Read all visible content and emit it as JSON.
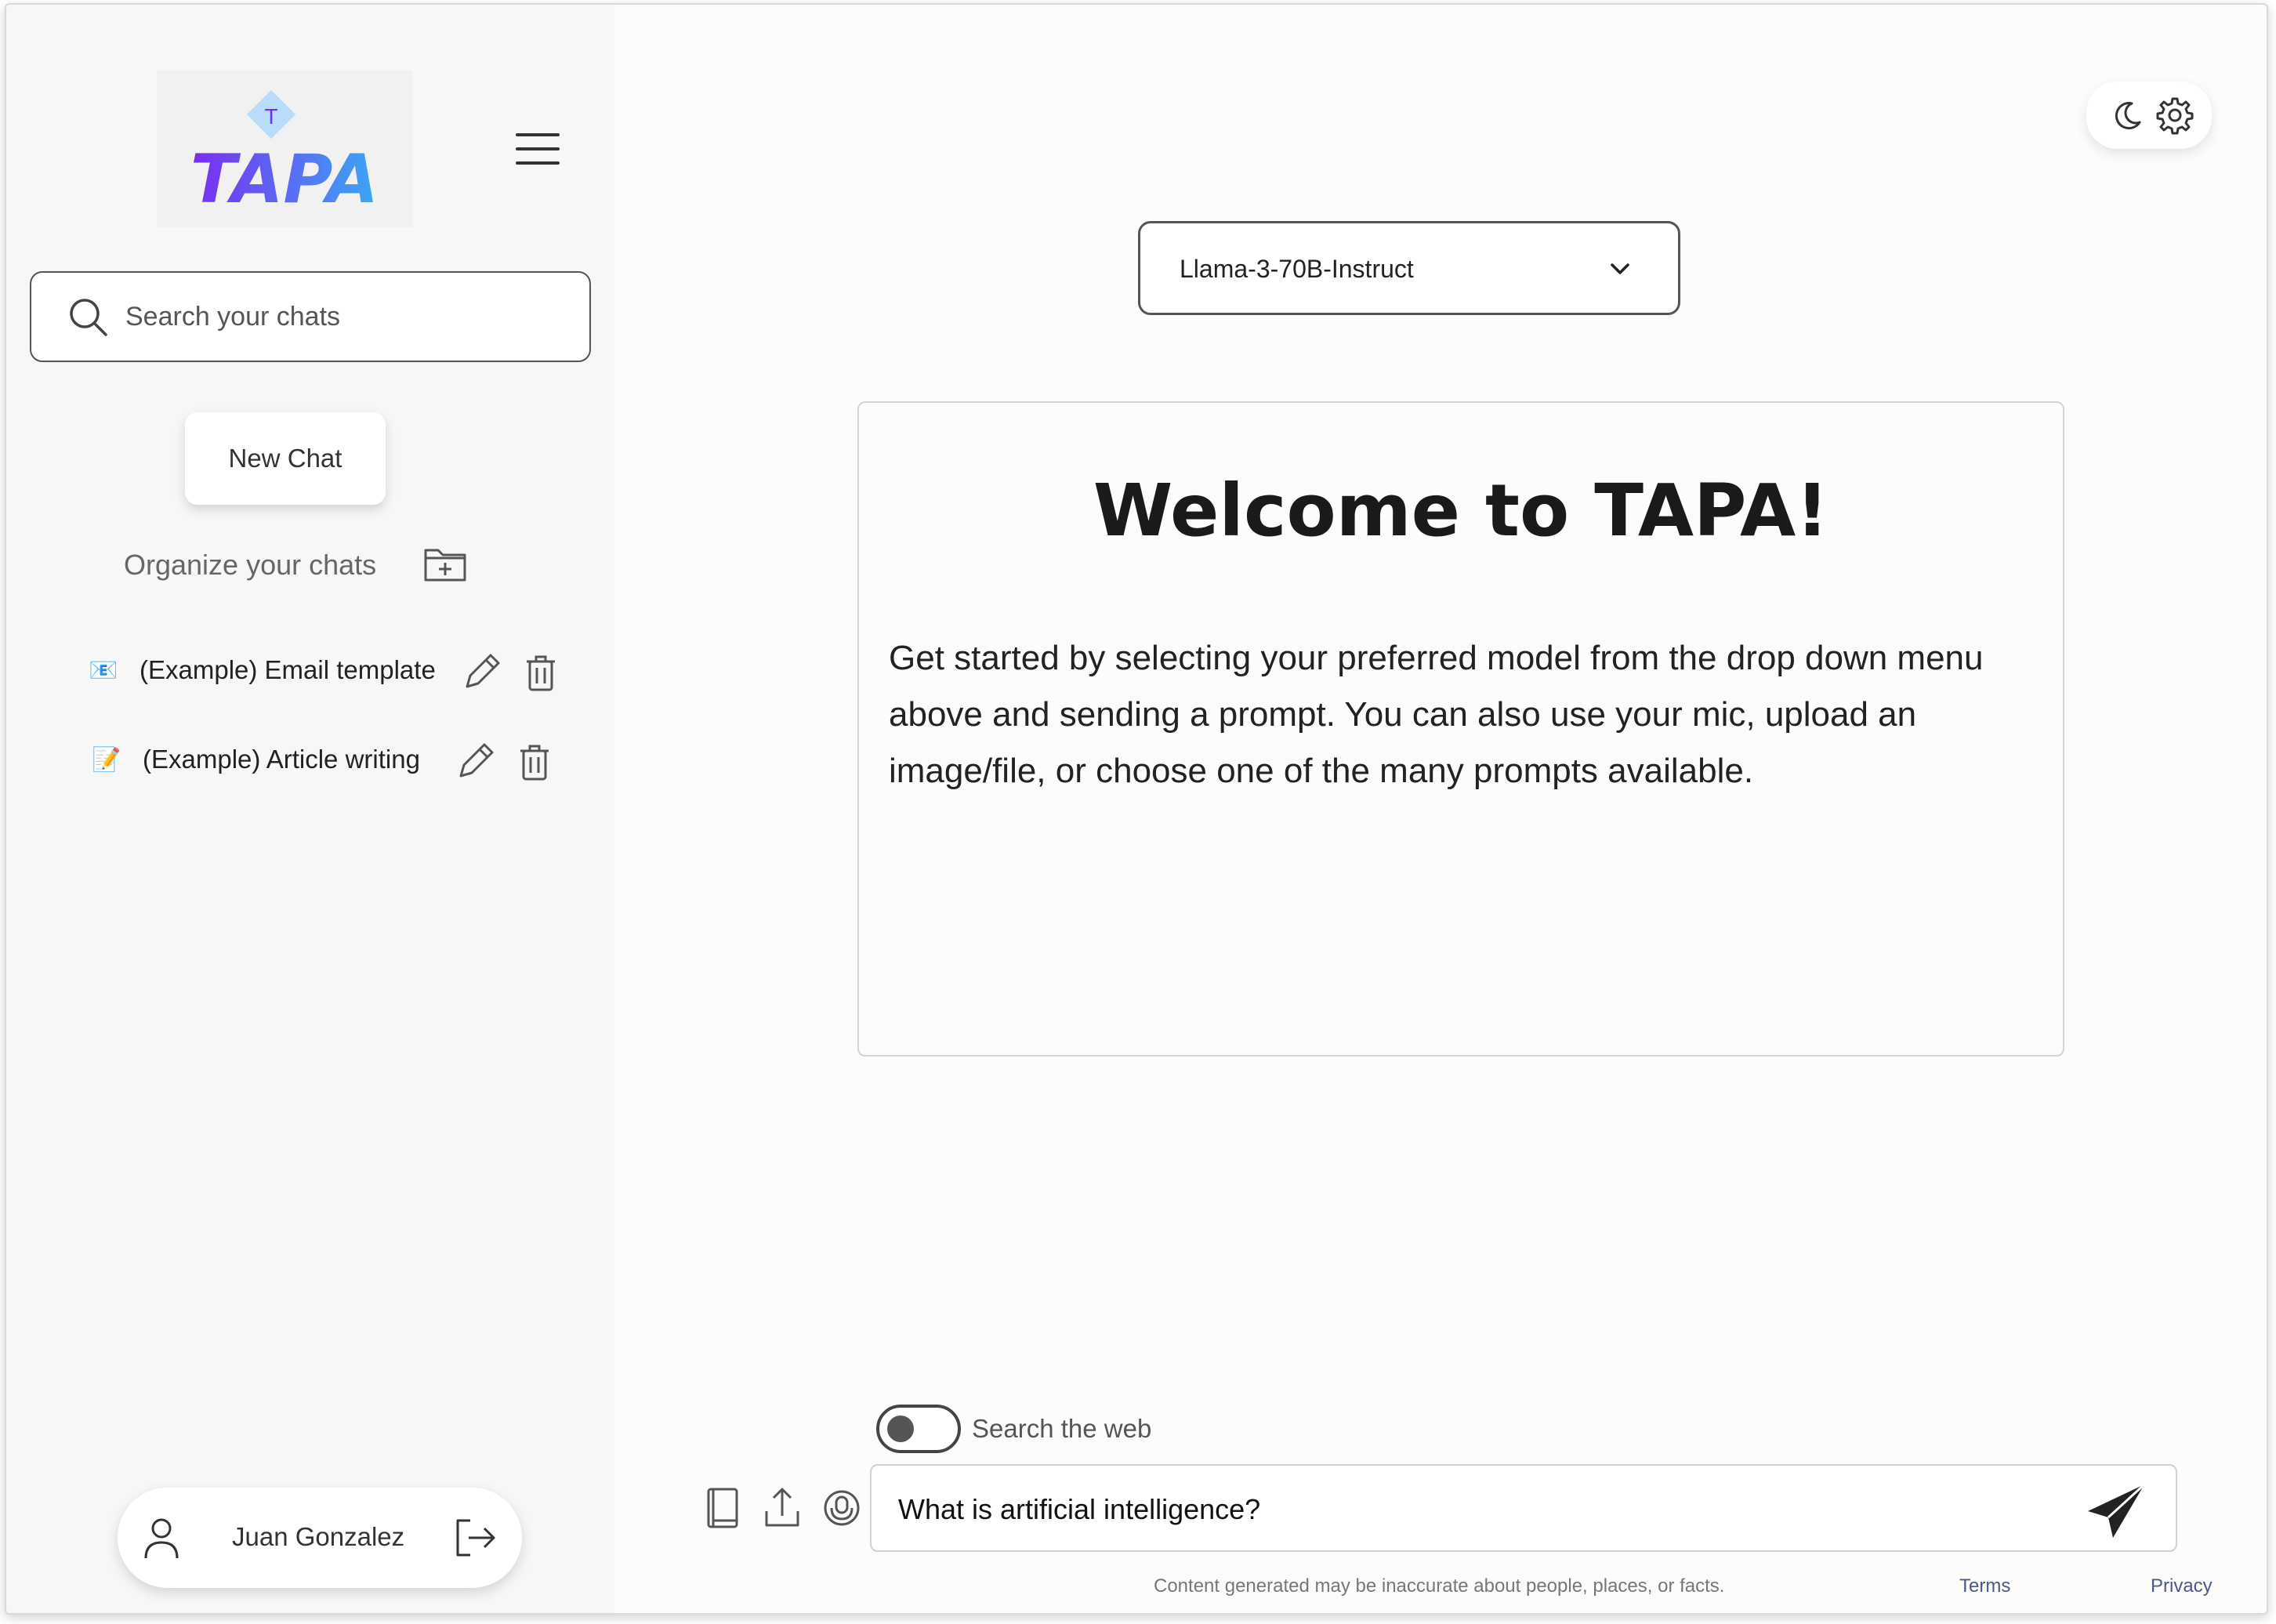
{
  "sidebar": {
    "logo_text": "TAPA",
    "logo_badge": "T",
    "search_placeholder": "Search your chats",
    "new_chat_label": "New Chat",
    "organize_label": "Organize your chats",
    "chats": [
      {
        "emoji": "📧",
        "label": "(Example) Email template"
      },
      {
        "emoji": "📝",
        "label": "(Example) Article writing"
      }
    ],
    "user_name": "Juan Gonzalez"
  },
  "main": {
    "model_selected": "Llama-3-70B-Instruct",
    "welcome_title": "Welcome to TAPA!",
    "welcome_text": "Get started by selecting your preferred model from the drop down menu above and sending a prompt. You can also use your mic, upload an image/file, or choose one of the many prompts available.",
    "search_web_label": "Search the web",
    "search_web_enabled": false,
    "prompt_value": "What is artificial intelligence?",
    "disclaimer": "Content generated may be inaccurate  about people, places, or facts.",
    "terms_label": "Terms",
    "privacy_label": "Privacy"
  },
  "colors": {
    "logo_gradient_start": "#7a2cf0",
    "logo_gradient_end": "#3aa8f5",
    "sidebar_bg": "#f7f7f7",
    "link": "#4a5a8a"
  }
}
